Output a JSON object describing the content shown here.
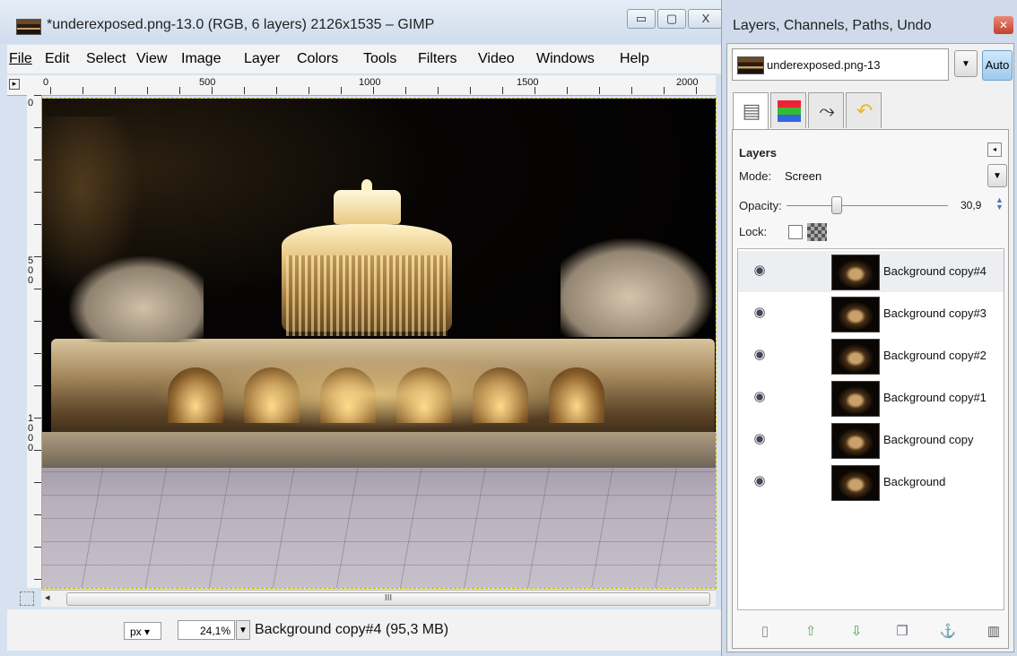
{
  "image_window": {
    "title": "*underexposed.png-13.0 (RGB, 6 layers) 2126x1535 – GIMP",
    "controls": {
      "minimize": "▭",
      "maximize": "▢",
      "close": "X"
    },
    "menus": [
      "File",
      "Edit",
      "Select",
      "View",
      "Image",
      "Layer",
      "Colors",
      "Tools",
      "Filters",
      "Video",
      "Windows",
      "Help"
    ],
    "ruler_h_labels": [
      "0",
      "500",
      "1000",
      "1500",
      "2000"
    ],
    "ruler_v_labels": [
      "0",
      "500",
      "1000"
    ],
    "scrollbar_grip": "III",
    "status": {
      "unit": "px",
      "zoom": "24,1%",
      "message": "Background copy#4 (95,3 MB)"
    }
  },
  "dock": {
    "title": "Layers, Channels, Paths, Undo",
    "image_selector": "underexposed.png-13",
    "auto_label": "Auto",
    "tabs": [
      "layers",
      "channels",
      "paths",
      "undo"
    ],
    "panel_title": "Layers",
    "mode_label": "Mode:",
    "mode_value": "Screen",
    "opacity_label": "Opacity:",
    "opacity_value": "30,9",
    "opacity_fraction": 0.309,
    "lock_label": "Lock:",
    "layers": [
      {
        "name": "Background copy#4",
        "visible": true,
        "selected": true
      },
      {
        "name": "Background copy#3",
        "visible": true,
        "selected": false
      },
      {
        "name": "Background copy#2",
        "visible": true,
        "selected": false
      },
      {
        "name": "Background copy#1",
        "visible": true,
        "selected": false
      },
      {
        "name": "Background copy",
        "visible": true,
        "selected": false
      },
      {
        "name": "Background",
        "visible": true,
        "selected": false
      }
    ],
    "bottom_buttons": [
      "new-layer",
      "raise-layer",
      "lower-layer",
      "duplicate-layer",
      "anchor-layer",
      "delete-layer"
    ]
  }
}
